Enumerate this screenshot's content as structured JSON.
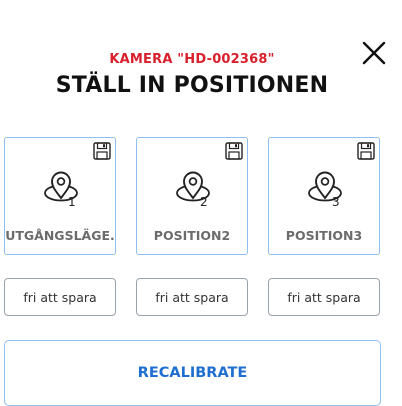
{
  "header": {
    "camera_name": "KAMERA \"HD-002368\"",
    "title": "STÄLL IN POSITIONEN"
  },
  "icons": {
    "close": "close-icon",
    "save": "floppy-disk-icon",
    "pin": "map-pin-icon"
  },
  "positions": [
    {
      "number": "1",
      "label": "UTGÅNGSLÄGE.",
      "save_label": "fri att spara"
    },
    {
      "number": "2",
      "label": "POSITION2",
      "save_label": "fri att spara"
    },
    {
      "number": "3",
      "label": "POSITION3",
      "save_label": "fri att spara"
    }
  ],
  "recalibrate_label": "RECALIBRATE",
  "colors": {
    "accent_red": "#d91f2b",
    "accent_blue": "#1f6fd1",
    "card_border": "#8fbef0"
  }
}
